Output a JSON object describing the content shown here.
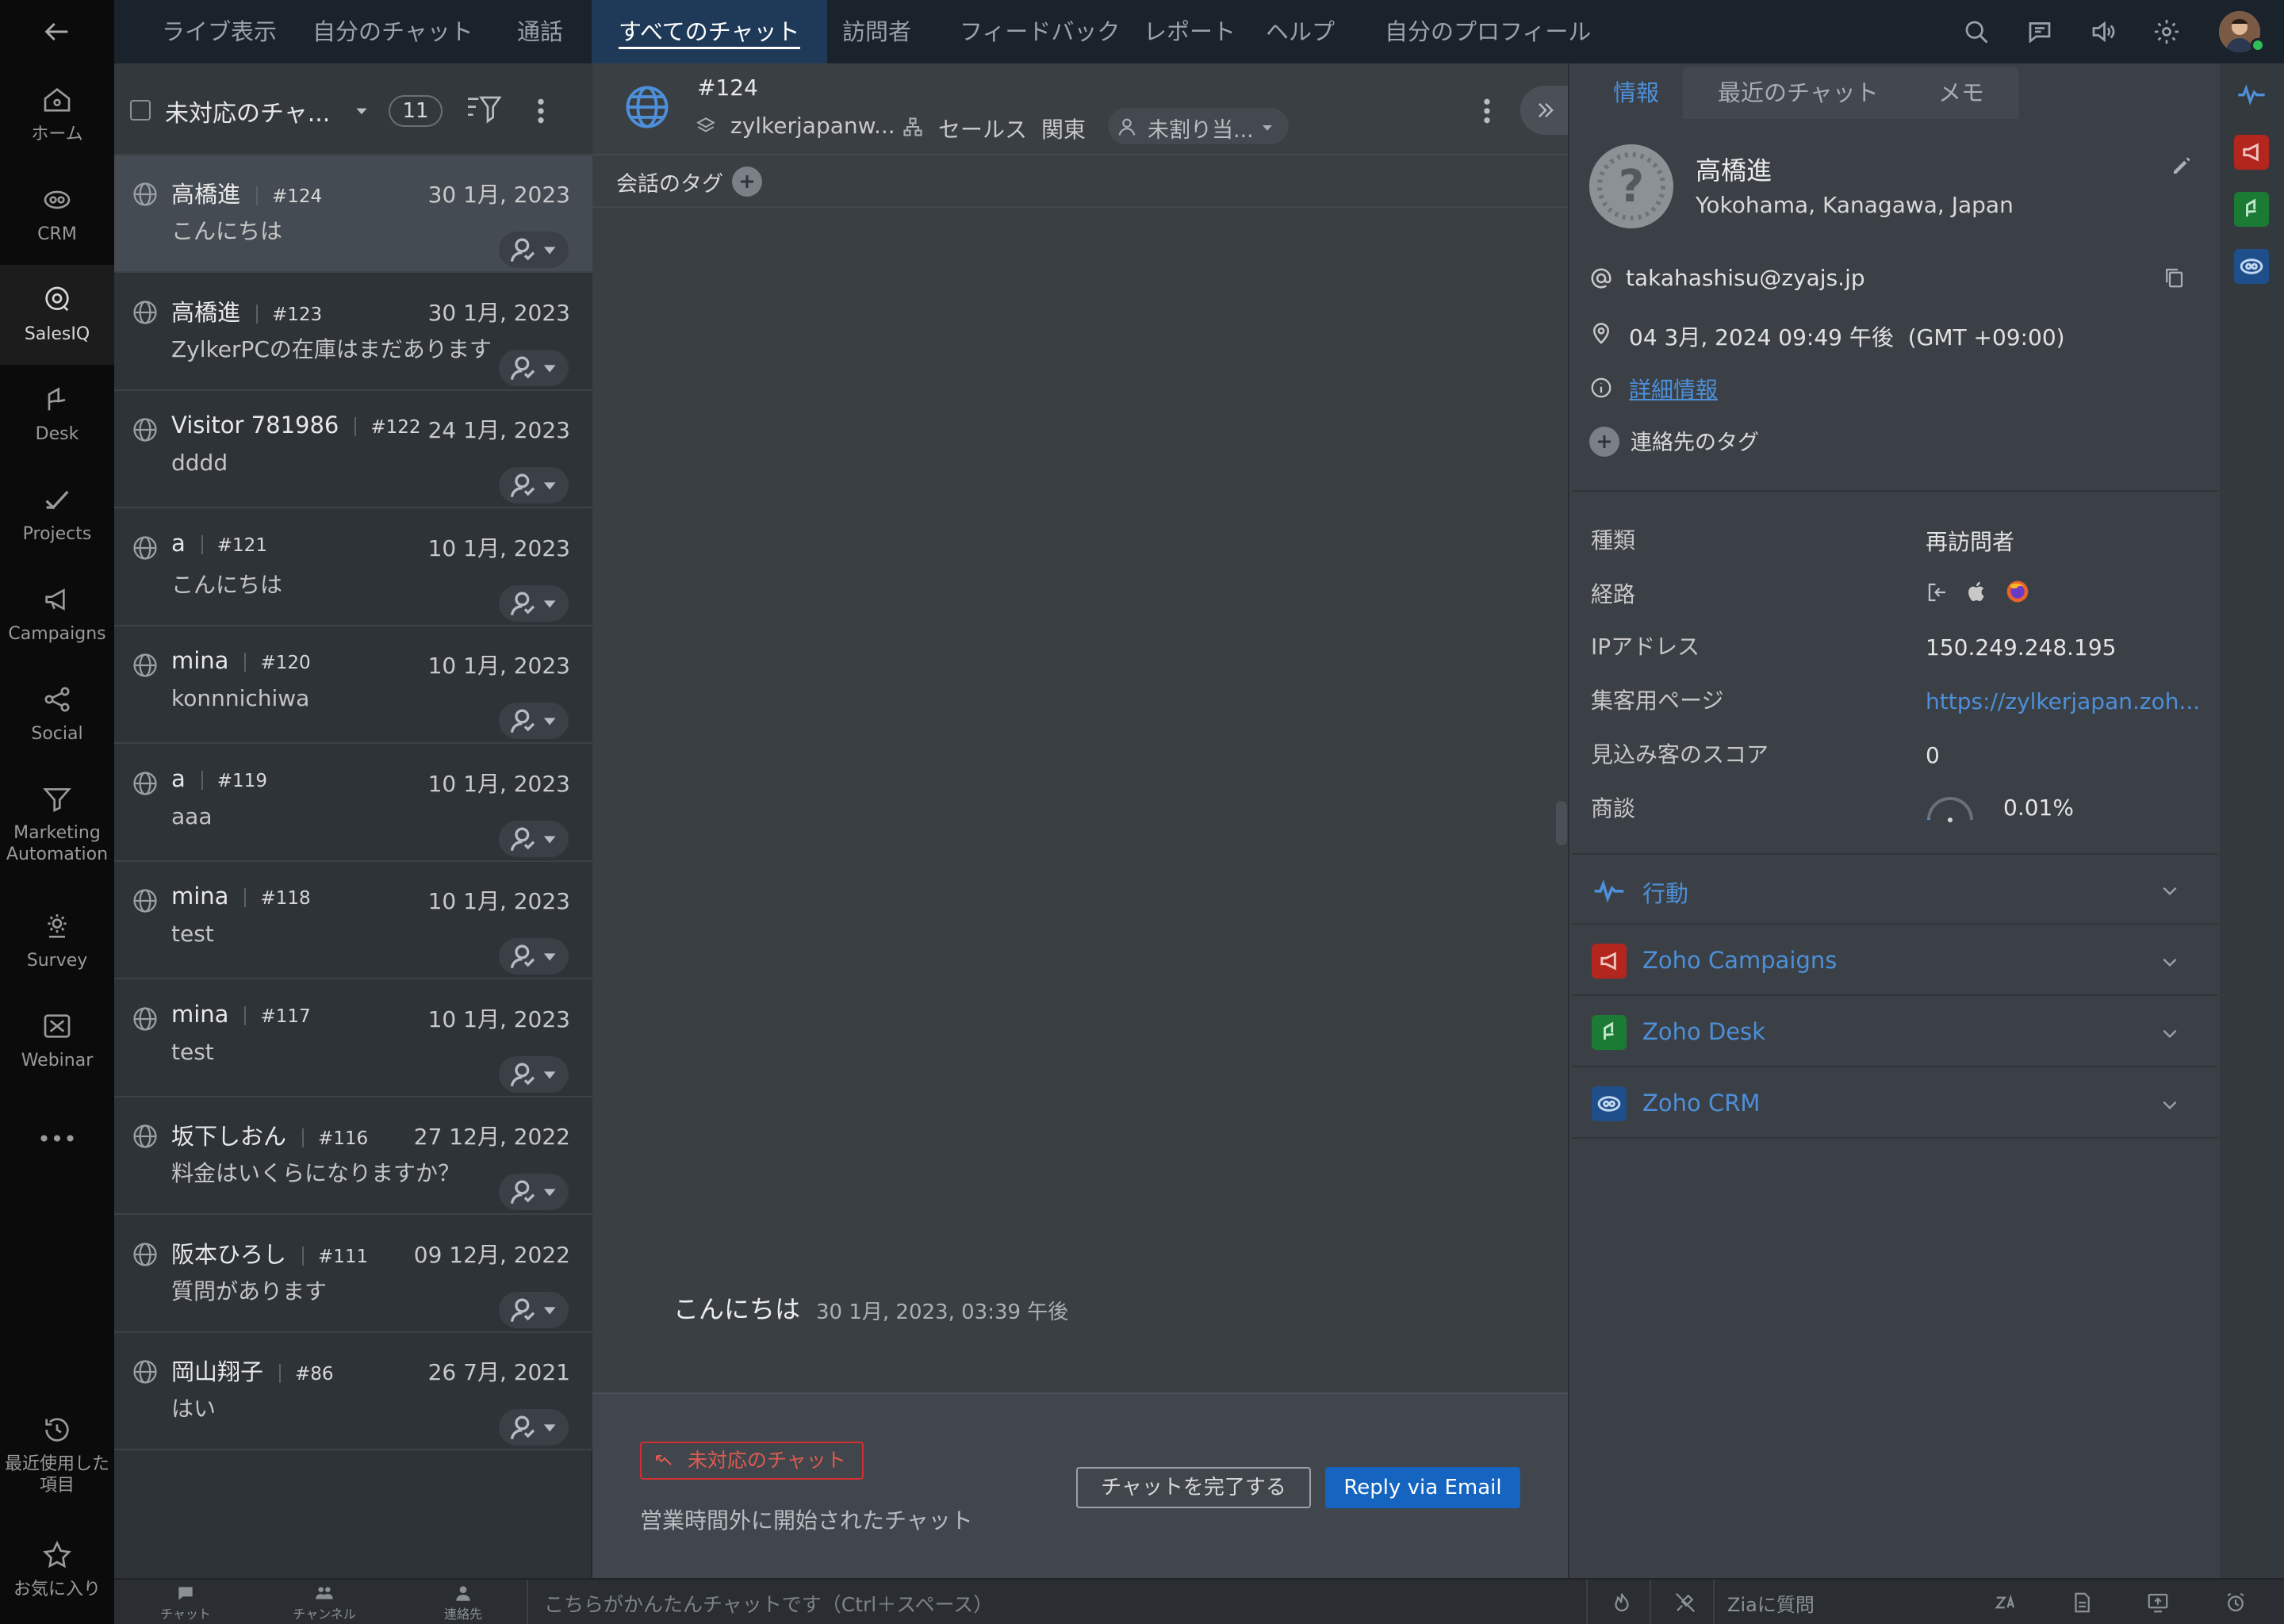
{
  "rail": {
    "items": [
      {
        "label": "ホーム",
        "icon": "home-icon"
      },
      {
        "label": "CRM",
        "icon": "crm-icon"
      },
      {
        "label": "SalesIQ",
        "icon": "salesiq-icon"
      },
      {
        "label": "Desk",
        "icon": "desk-icon"
      },
      {
        "label": "Projects",
        "icon": "projects-icon"
      },
      {
        "label": "Campaigns",
        "icon": "megaphone-icon"
      },
      {
        "label": "Social",
        "icon": "social-icon"
      },
      {
        "label": "Marketing Automation",
        "icon": "marketing-automation-icon"
      },
      {
        "label": "Survey",
        "icon": "survey-icon"
      },
      {
        "label": "Webinar",
        "icon": "webinar-icon"
      }
    ],
    "more": "•••",
    "recent_label": "最近使用した項目",
    "favorites_label": "お気に入り"
  },
  "topnav": {
    "tabs": [
      "ライブ表示",
      "自分のチャット",
      "通話",
      "すべてのチャット",
      "訪問者",
      "フィードバック",
      "レポート",
      "ヘルプ",
      "自分のプロフィール"
    ],
    "active_tab": "すべてのチャット"
  },
  "chat_list": {
    "filter_label": "未対応のチャ...",
    "count": "11",
    "rows": [
      {
        "name": "高橋進",
        "id": "#124",
        "date": "30 1月, 2023",
        "message": "こんにちは"
      },
      {
        "name": "高橋進",
        "id": "#123",
        "date": "30 1月, 2023",
        "message": "ZylkerPCの在庫はまだあります"
      },
      {
        "name": "Visitor 781986",
        "id": "#122",
        "date": "24 1月, 2023",
        "message": "dddd"
      },
      {
        "name": "a",
        "id": "#121",
        "date": "10 1月, 2023",
        "message": "こんにちは"
      },
      {
        "name": "mina",
        "id": "#120",
        "date": "10 1月, 2023",
        "message": "konnnichiwa"
      },
      {
        "name": "a",
        "id": "#119",
        "date": "10 1月, 2023",
        "message": "aaa"
      },
      {
        "name": "mina",
        "id": "#118",
        "date": "10 1月, 2023",
        "message": "test"
      },
      {
        "name": "mina",
        "id": "#117",
        "date": "10 1月, 2023",
        "message": "test"
      },
      {
        "name": "坂下しおん",
        "id": "#116",
        "date": "27 12月, 2022",
        "message": "料金はいくらになりますか？"
      },
      {
        "name": "阪本ひろし",
        "id": "#111",
        "date": "09 12月, 2022",
        "message": "質問があります"
      },
      {
        "name": "岡山翔子",
        "id": "#86",
        "date": "26 7月, 2021",
        "message": "はい"
      }
    ]
  },
  "chat_header": {
    "id": "#124",
    "portal": "zylkerjapanw...",
    "department": "セールス",
    "related": "関東",
    "assignee": "未割り当..."
  },
  "tags": {
    "label": "会話のタグ"
  },
  "chat_message": {
    "text": "こんにちは",
    "time": "30 1月, 2023, 03:39 午後"
  },
  "chat_footer": {
    "status_badge": "未対応のチャット",
    "note": "営業時間外に開始されたチャット",
    "complete_button": "チャットを完了する",
    "reply_button": "Reply via Email"
  },
  "info_panel": {
    "tabs": [
      "情報",
      "最近のチャット",
      "メモ"
    ],
    "name": "高橋進",
    "location": "Yokohama, Kanagawa, Japan",
    "email": "takahashisu@zyajs.jp",
    "local_time": "04 3月, 2024 09:49 午後",
    "timezone": "(GMT +09:00)",
    "details_link": "詳細情報",
    "contact_tags": "連絡先のタグ",
    "fields": [
      {
        "key": "種類",
        "value": "再訪問者"
      },
      {
        "key": "経路",
        "value": ""
      },
      {
        "key": "IPアドレス",
        "value": "150.249.248.195"
      },
      {
        "key": "集客用ページ",
        "value": "https://zylkerjapan.zoh..."
      },
      {
        "key": "見込み客のスコア",
        "value": "0"
      },
      {
        "key": "商談",
        "value": "0.01%"
      }
    ],
    "deal_probability": 0.0001,
    "sections": [
      {
        "title": "行動",
        "icon": "activity-icon",
        "color": ""
      },
      {
        "title": "Zoho Campaigns",
        "icon": "campaigns-icon",
        "color": "#b3261e"
      },
      {
        "title": "Zoho Desk",
        "icon": "desk-icon",
        "color": "#1b7a34"
      },
      {
        "title": "Zoho CRM",
        "icon": "crm-icon",
        "color": "#1f4f8a"
      }
    ]
  },
  "bottom_bar": {
    "items": [
      "チャット",
      "チャンネル",
      "連絡先"
    ],
    "quick_chat_placeholder": "こちらがかんたんチャットです（Ctrl＋スペース）",
    "zia_label": "Ziaに質問"
  },
  "colors": {
    "accent": "#4d8fd9",
    "primary_button": "#1565c0",
    "danger": "#d32f2f"
  }
}
